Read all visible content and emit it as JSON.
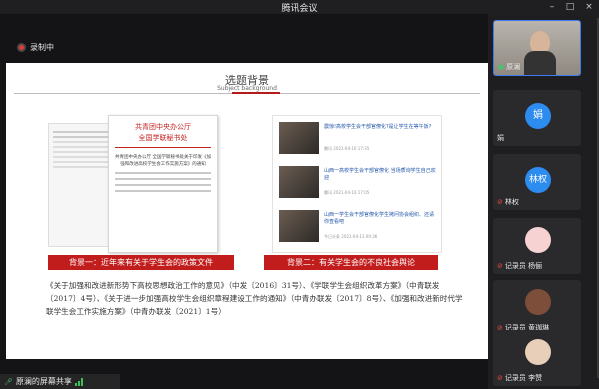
{
  "window": {
    "title": "腾讯会议"
  },
  "recording": {
    "label": "录制中"
  },
  "slide": {
    "title": "选题背景",
    "subtitle": "Subject background",
    "doc_header_line1": "共青团中央办公厅",
    "doc_header_line2": "全国学联秘书处",
    "doc_body": "共青团中央办公厅 全国学联秘书处关于印发《加强和改进高校学生会工作实施方案》的通知",
    "news": [
      {
        "headline": "震惊!高校学生会干部官僚化?是让学生在等午饭?",
        "meta": "腾讯 2021-04-16 17:35"
      },
      {
        "headline": "山西一高校学生会干部官僚化 当场质询学生自己欢迎",
        "meta": "腾讯 2021-04-10 17:05"
      },
      {
        "headline": "山西一学生会干部官僚化学生拷问协会组织、还请你查看吧",
        "meta": "今日头条 2021-04-13 00:36"
      }
    ],
    "banner_left": "背景一：近年来有关于学生会的政策文件",
    "banner_right": "背景二：有关学生会的不良社会舆论",
    "paragraph": "《关于加强和改进新形势下高校思想政治工作的意见》（中发〔2016〕31号）、《学联学生会组织改革方案》（中青联发〔2017〕4号）、《关于进一步加强高校学生会组织章程建设工作的通知》（中青办联发〔2017〕8号）、《加强和改进新时代学联学生会工作实施方案》（中青办联发〔2021〕1号）"
  },
  "share_bar": {
    "label": "原澜的屏幕共享"
  },
  "participants": [
    {
      "name": "原澜",
      "avatar_text": "",
      "color": "#3a3a3a",
      "mic": "on",
      "type": "video"
    },
    {
      "name": "娟",
      "avatar_text": "娟",
      "color": "#2d8cf0",
      "mic": "off",
      "type": "initial"
    },
    {
      "name": "林权",
      "avatar_text": "林权",
      "color": "#2d8cf0",
      "mic": "off",
      "type": "initial"
    },
    {
      "name": "记录员 杨俪",
      "avatar_text": "",
      "color": "#f4c9c9",
      "mic": "off",
      "type": "image"
    },
    {
      "name": "记录员 黄珈琳",
      "avatar_text": "",
      "color": "#8a5a44",
      "mic": "off",
      "type": "image"
    },
    {
      "name": "记录员 李赞",
      "avatar_text": "",
      "color": "#e9d3c0",
      "mic": "off",
      "type": "image"
    }
  ]
}
